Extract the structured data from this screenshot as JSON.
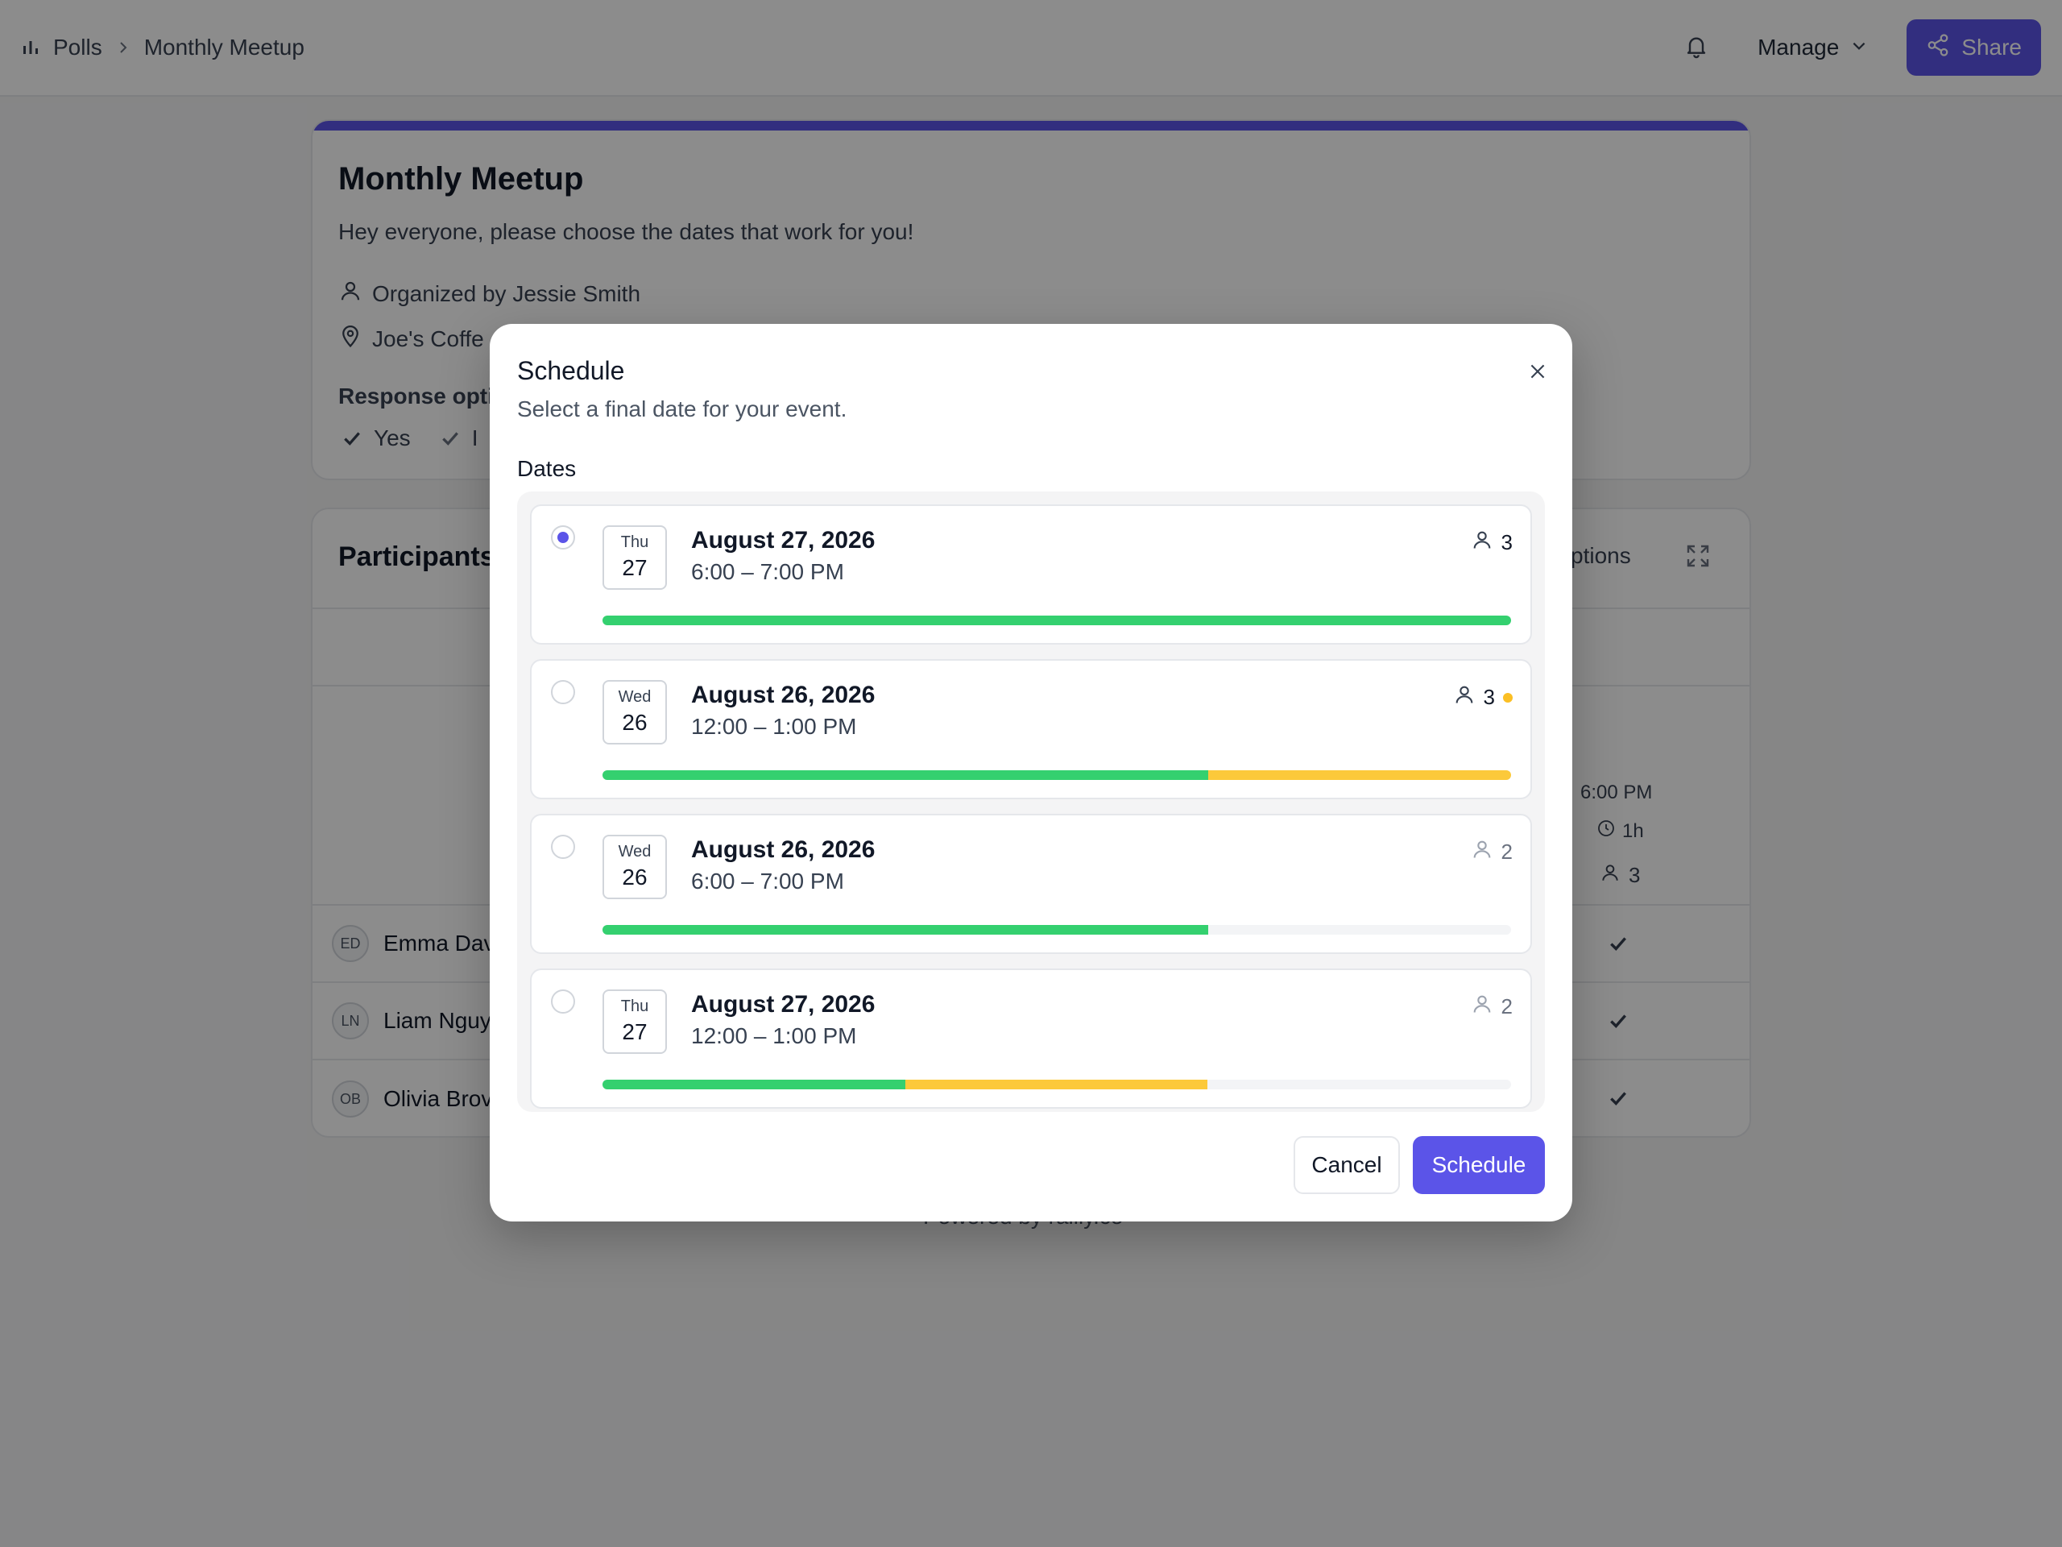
{
  "header": {
    "breadcrumb_root": "Polls",
    "breadcrumb_current": "Monthly Meetup",
    "manage_label": "Manage",
    "share_label": "Share"
  },
  "poll": {
    "title": "Monthly Meetup",
    "description": "Hey everyone, please choose the dates that work for you!",
    "organizer": "Organized by Jessie Smith",
    "location": "Joe's Coffe",
    "response_options_title": "Response opti",
    "response_yes": "Yes",
    "response_if_need_be": "I"
  },
  "participants": {
    "title": "Participants",
    "options_label": "ptions",
    "column_time": "6:00 PM",
    "column_duration": "1h",
    "column_count": "3",
    "rows": [
      {
        "initials": "ED",
        "name": "Emma Dav"
      },
      {
        "initials": "LN",
        "name": "Liam Nguy"
      },
      {
        "initials": "OB",
        "name": "Olivia Brov"
      }
    ]
  },
  "footer": {
    "powered_by": "Powered by rallly.co"
  },
  "modal": {
    "title": "Schedule",
    "subtitle": "Select a final date for your event.",
    "dates_label": "Dates",
    "cancel_label": "Cancel",
    "schedule_label": "Schedule",
    "options": [
      {
        "dow": "Thu",
        "day": "27",
        "date": "August 27, 2026",
        "time": "6:00 – 7:00 PM",
        "count": "3",
        "selected": true,
        "yes_fraction": 1.0,
        "ifneedbe_fraction": 0.0
      },
      {
        "dow": "Wed",
        "day": "26",
        "date": "August 26, 2026",
        "time": "12:00 – 1:00 PM",
        "count": "3",
        "selected": false,
        "yes_fraction": 0.667,
        "ifneedbe_fraction": 0.333
      },
      {
        "dow": "Wed",
        "day": "26",
        "date": "August 26, 2026",
        "time": "6:00 – 7:00 PM",
        "count": "2",
        "selected": false,
        "yes_fraction": 0.667,
        "ifneedbe_fraction": 0.0
      },
      {
        "dow": "Thu",
        "day": "27",
        "date": "August 27, 2026",
        "time": "12:00 – 1:00 PM",
        "count": "2",
        "selected": false,
        "yes_fraction": 0.333,
        "ifneedbe_fraction": 0.333
      }
    ]
  },
  "colors": {
    "primary": "#5b54e8",
    "yes": "#34d06f",
    "if_need_be": "#fcc93a"
  }
}
